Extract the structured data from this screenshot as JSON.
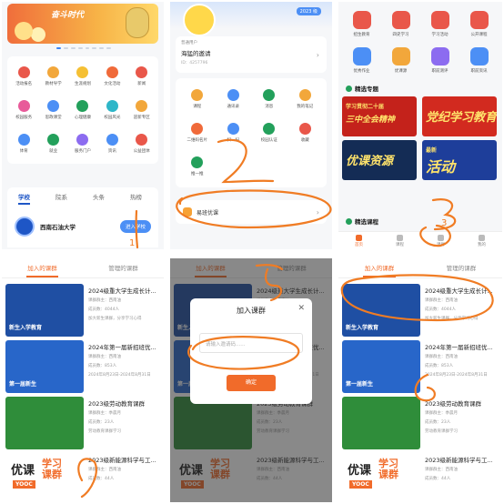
{
  "panel1": {
    "banner_text": "奋斗时代",
    "grid": [
      {
        "label": "活动报名",
        "color": "#e9574a"
      },
      {
        "label": "教材导学",
        "color": "#f2a73b"
      },
      {
        "label": "生涯规划",
        "color": "#f5c034"
      },
      {
        "label": "文化活动",
        "color": "#f06a3a"
      },
      {
        "label": "新闻",
        "color": "#e9574a"
      },
      {
        "label": "校园服务",
        "color": "#e85b9a"
      },
      {
        "label": "思政课堂",
        "color": "#4c8ff5"
      },
      {
        "label": "心理健康",
        "color": "#23a05b"
      },
      {
        "label": "校园风光",
        "color": "#2eb6c8"
      },
      {
        "label": "迎新专区",
        "color": "#f2a73b"
      },
      {
        "label": "体育",
        "color": "#4c8ff5"
      },
      {
        "label": "就业",
        "color": "#23a05b"
      },
      {
        "label": "服务门户",
        "color": "#8c6cf0"
      },
      {
        "label": "资讯",
        "color": "#4c8ff5"
      },
      {
        "label": "公益团体",
        "color": "#e9574a"
      }
    ],
    "tabs": [
      "学校",
      "院系",
      "头条",
      "热榜"
    ],
    "school_name": "西南石油大学",
    "join_label": "进入学校",
    "annotation": "1"
  },
  "panel2": {
    "badge": "2023 级",
    "tag": "普通用户",
    "user_name": "海猛的邀请",
    "user_id": "ID：4257796",
    "grid": [
      {
        "label": "课程",
        "color": "#f2a73b"
      },
      {
        "label": "通讯录",
        "color": "#4c8ff5"
      },
      {
        "label": "消息",
        "color": "#23a05b"
      },
      {
        "label": "我的笔记",
        "color": "#f2a73b"
      },
      {
        "label": "二维码名片",
        "color": "#f06a3a"
      },
      {
        "label": "扫一扫",
        "color": "#4c8ff5"
      },
      {
        "label": "校园认证",
        "color": "#23a05b"
      },
      {
        "label": "收藏",
        "color": "#e9574a"
      },
      {
        "label": "推一推",
        "color": "#23a05b"
      }
    ],
    "entry_label": "易班优课",
    "annotation": "2"
  },
  "panel3": {
    "grid": [
      {
        "label": "招生教育",
        "color": "#e9574a"
      },
      {
        "label": "四史学习",
        "color": "#e9574a"
      },
      {
        "label": "学习活动",
        "color": "#e9574a"
      },
      {
        "label": "公开课程",
        "color": "#e9574a"
      },
      {
        "label": "优秀作业",
        "color": "#4c8ff5"
      },
      {
        "label": "优课源",
        "color": "#f2a73b"
      },
      {
        "label": "职前测评",
        "color": "#8c6cf0"
      },
      {
        "label": "职前资讯",
        "color": "#4c8ff5"
      }
    ],
    "section1": "精选专题",
    "banners": [
      {
        "small": "学习贯彻二十届",
        "big": "三中全会精神",
        "color": "#c4221b"
      },
      {
        "small": "",
        "big": "党纪学习教育",
        "color": "#d22a1f"
      },
      {
        "small": "",
        "big": "优课资源",
        "color": "#142c55"
      },
      {
        "small": "最新",
        "big": "活动",
        "color": "#1e3e9a"
      }
    ],
    "section2": "精选课程",
    "nav": [
      "首页",
      "课程",
      "课群",
      "我的"
    ],
    "annotation": "3"
  },
  "courses": [
    {
      "title": "2024级重大学生成长计...",
      "meta1": "课群群主：西南油",
      "meta2": "成员数：4044人",
      "meta3": "加大新生课群，分享学习心得",
      "thumb_color": "#1f4fa3",
      "thumb_text": "新生入学教育"
    },
    {
      "title": "2024年第一届新招班优...",
      "meta1": "课群群主：西南油",
      "meta2": "成员数：853人",
      "meta3": "2024年8月23日-2024年8月31日",
      "thumb_color": "#2866c9",
      "thumb_text": "第一届新生"
    },
    {
      "title": "2023级劳动教育课群",
      "meta1": "课群群主：季晨月",
      "meta2": "成员数：23人",
      "meta3": "劳动教育课群学习",
      "thumb_color": "#2f8d3a",
      "thumb_text": ""
    },
    {
      "title": "2023级新能源科学与工...",
      "meta1": "课群群主：西南油",
      "meta2": "成员数：44人",
      "meta3": "",
      "thumb_color": "#ffffff",
      "thumb_text": ""
    }
  ],
  "course_tabs": [
    "加入的课群",
    "管理的课群"
  ],
  "yooc": {
    "word1": "优课",
    "word2": "学习",
    "word3": "课群",
    "tag": "YOOC"
  },
  "dialog": {
    "title": "加入课群",
    "close": "✕",
    "placeholder": "请输入邀请码......",
    "confirm": "确定"
  },
  "annotations": {
    "p4": "1",
    "p5": "5",
    "p6": "6"
  },
  "colors": {
    "accent": "#f16b2a",
    "blue": "#4c8ff5",
    "ink": "#f07c24"
  }
}
